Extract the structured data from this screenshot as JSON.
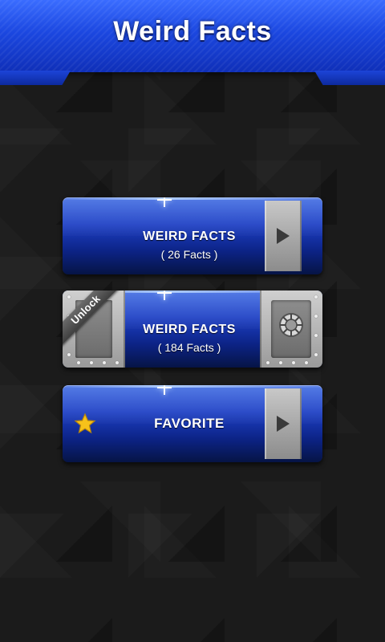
{
  "header": {
    "title": "Weird Facts"
  },
  "menu": {
    "items": [
      {
        "title": "WEIRD FACTS",
        "subtitle": "( 26 Facts )",
        "locked": false
      },
      {
        "title": "WEIRD FACTS",
        "subtitle": "( 184 Facts )",
        "locked": true,
        "badge": "Unlock"
      },
      {
        "title": "FAVORITE",
        "locked": false
      }
    ]
  },
  "icons": {
    "play": "play-arrow-icon",
    "vault": "vault-lock-icon",
    "star": "star-icon"
  },
  "colors": {
    "header_blue": "#1b47e0",
    "button_blue": "#1d3fc4",
    "metal_gray": "#b6b6b6",
    "star_gold": "#f7c21a",
    "background": "#1b1b1b"
  }
}
